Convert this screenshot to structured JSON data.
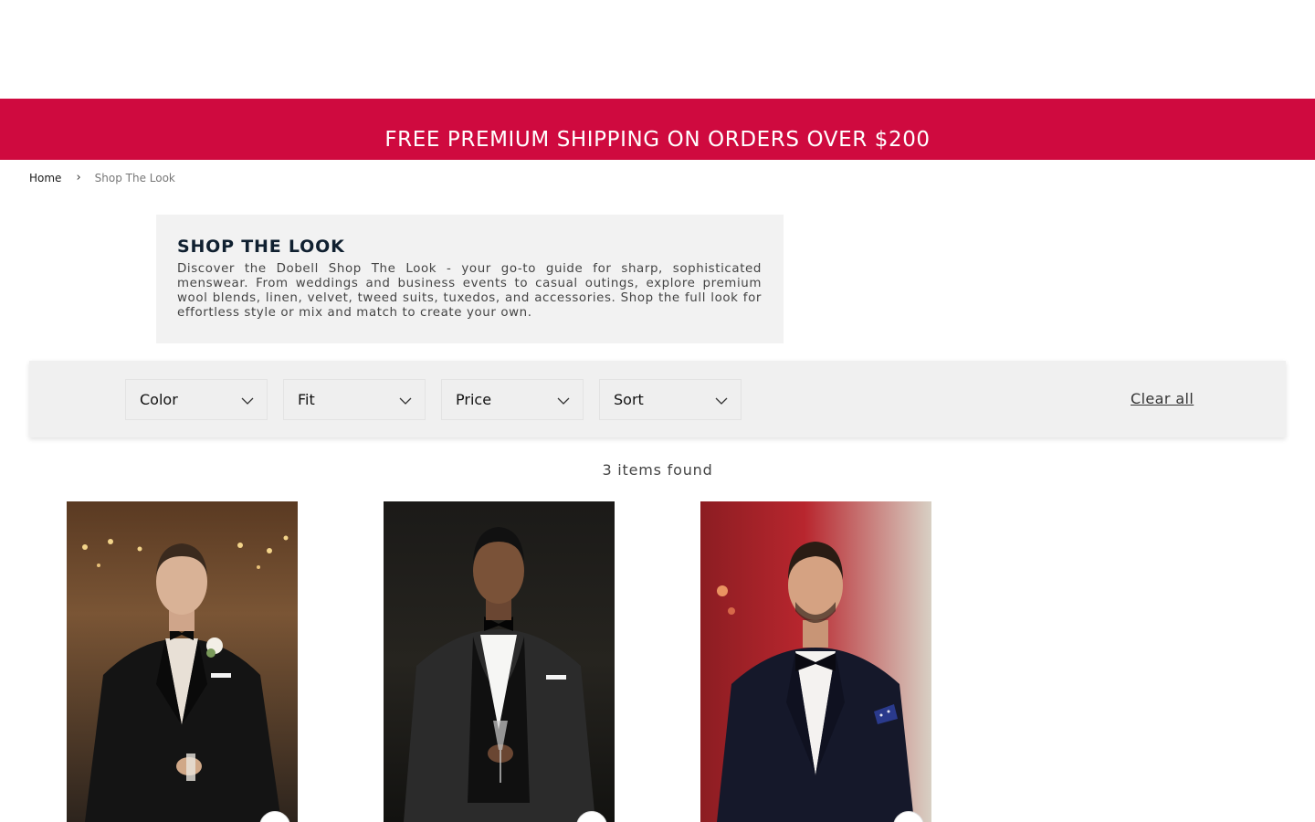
{
  "promo": {
    "text": "FREE PREMIUM SHIPPING ON ORDERS OVER $200"
  },
  "breadcrumb": {
    "home": "Home",
    "separator": "›",
    "current": "Shop The Look"
  },
  "intro": {
    "title": "SHOP THE LOOK",
    "description": "Discover the Dobell Shop The Look - your go-to guide for sharp, sophisticated menswear. From weddings and business events to casual outings, explore premium wool blends, linen, velvet, tweed suits, tuxedos, and accessories. Shop the full look for effortless style or mix and match to create your own."
  },
  "filters": {
    "items": [
      {
        "label": "Color"
      },
      {
        "label": "Fit"
      },
      {
        "label": "Price"
      },
      {
        "label": "Sort"
      }
    ],
    "clear_all": "Clear all"
  },
  "results": {
    "count_text": "3 items found"
  },
  "products": [
    {
      "image": "man-in-black-tuxedo-with-boutonniere"
    },
    {
      "image": "man-in-black-shawl-collar-tuxedo"
    },
    {
      "image": "man-in-navy-tuxedo-with-pocket-square"
    }
  ],
  "colors": {
    "promo_bg": "#cf0a3f",
    "panel_bg": "#f2f2f2",
    "filter_bg": "#f0f0f0"
  }
}
